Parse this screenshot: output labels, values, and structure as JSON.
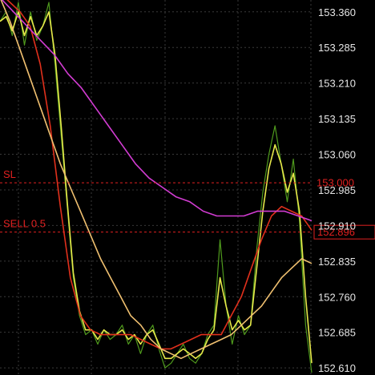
{
  "colors": {
    "background": "#000000",
    "grid": "#3a3a3a",
    "axis_text": "#e6e6e6",
    "price_line_green": "#4f9a1d",
    "fast_ma_yellow": "#e6e84a",
    "ma_red": "#e0301c",
    "ma_orange": "#f0c070",
    "ma_magenta": "#d23cd2",
    "order_red": "#e02020",
    "current_price_bg": "#000000"
  },
  "price_axis": {
    "ticks": [
      "153.360",
      "153.285",
      "153.210",
      "153.135",
      "153.060",
      "152.985",
      "152.910",
      "152.835",
      "152.760",
      "152.685",
      "152.610"
    ]
  },
  "sl_line": {
    "label": "SL",
    "price_tag": "153.000"
  },
  "sell_line": {
    "label": "SELL 0.5",
    "price_tag": "152.896"
  },
  "chart_data": {
    "type": "line",
    "ylim": [
      152.595,
      153.385
    ],
    "grid": "vertical and horizontal",
    "series": [
      {
        "color": "#4f9a1d",
        "values": [
          153.34,
          153.36,
          153.31,
          153.38,
          153.29,
          153.36,
          153.3,
          153.33,
          153.38,
          153.25,
          153.1,
          152.95,
          152.8,
          152.72,
          152.68,
          152.69,
          152.66,
          152.69,
          152.67,
          152.68,
          152.7,
          152.66,
          152.68,
          152.64,
          152.68,
          152.7,
          152.65,
          152.61,
          152.62,
          152.64,
          152.66,
          152.63,
          152.62,
          152.64,
          152.68,
          152.7,
          152.88,
          152.74,
          152.66,
          152.72,
          152.68,
          152.7,
          152.86,
          152.98,
          153.06,
          153.12,
          153.04,
          152.96,
          153.05,
          152.92,
          152.7,
          152.6
        ]
      },
      {
        "color": "#e6e84a",
        "values": [
          153.34,
          153.35,
          153.32,
          153.36,
          153.31,
          153.35,
          153.31,
          153.33,
          153.36,
          153.27,
          153.12,
          152.96,
          152.81,
          152.73,
          152.69,
          152.69,
          152.67,
          152.69,
          152.68,
          152.68,
          152.69,
          152.67,
          152.68,
          152.66,
          152.68,
          152.69,
          152.66,
          152.63,
          152.63,
          152.64,
          152.65,
          152.64,
          152.63,
          152.64,
          152.67,
          152.69,
          152.8,
          152.74,
          152.69,
          152.71,
          152.69,
          152.7,
          152.82,
          152.94,
          153.03,
          153.08,
          153.04,
          152.98,
          153.02,
          152.94,
          152.76,
          152.62
        ]
      },
      {
        "color": "#e0301c",
        "values": [
          153.4,
          153.38,
          153.36,
          153.33,
          153.25,
          153.12,
          152.95,
          152.8,
          152.72,
          152.69,
          152.68,
          152.68,
          152.68,
          152.68,
          152.67,
          152.66,
          152.65,
          152.65,
          152.66,
          152.67,
          152.68,
          152.68,
          152.68,
          152.72,
          152.76,
          152.82,
          152.88,
          152.93,
          152.95,
          152.94,
          152.93,
          152.9
        ]
      },
      {
        "color": "#f0c070",
        "values": [
          153.39,
          153.34,
          153.28,
          153.22,
          153.16,
          153.1,
          153.04,
          152.99,
          152.94,
          152.89,
          152.84,
          152.8,
          152.76,
          152.72,
          152.7,
          152.67,
          152.65,
          152.64,
          152.63,
          152.64,
          152.65,
          152.66,
          152.67,
          152.68,
          152.7,
          152.72,
          152.74,
          152.77,
          152.8,
          152.82,
          152.84,
          152.83
        ]
      },
      {
        "color": "#d23cd2",
        "values": [
          153.39,
          153.36,
          153.33,
          153.3,
          153.27,
          153.23,
          153.2,
          153.16,
          153.12,
          153.08,
          153.04,
          153.01,
          152.99,
          152.97,
          152.96,
          152.94,
          152.93,
          152.93,
          152.93,
          152.94,
          152.94,
          152.94,
          152.93,
          152.92
        ]
      }
    ]
  }
}
